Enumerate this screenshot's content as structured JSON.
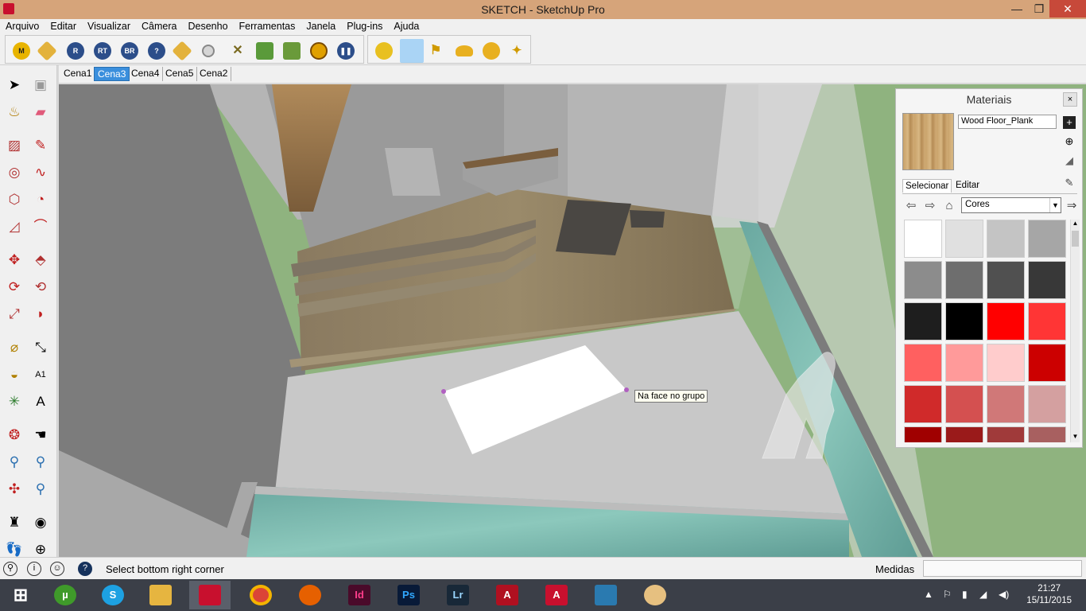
{
  "window": {
    "title": "SKETCH - SketchUp Pro",
    "controls": [
      "—",
      "❐",
      "✕"
    ]
  },
  "menu": [
    "Arquivo",
    "Editar",
    "Visualizar",
    "Câmera",
    "Desenho",
    "Ferramentas",
    "Janela",
    "Plug-ins",
    "Ajuda"
  ],
  "toolbar": {
    "plugin_labels": [
      "M",
      "R",
      "RT",
      "BR",
      "?"
    ]
  },
  "scenes": {
    "tabs": [
      "Cena1",
      "Cena3",
      "Cena4",
      "Cena5",
      "Cena2"
    ],
    "active": "Cena3"
  },
  "viewport": {
    "tooltip": "Na face no grupo"
  },
  "materials": {
    "title": "Materiais",
    "close": "×",
    "name": "Wood Floor_Plank",
    "tabs": [
      "Selecionar",
      "Editar"
    ],
    "library": "Cores",
    "swatch_colors": [
      "#ffffff",
      "#e0e0e0",
      "#c4c4c4",
      "#a6a6a6",
      "#8c8c8c",
      "#6e6e6e",
      "#505050",
      "#383838",
      "#1e1e1e",
      "#000000",
      "#ff0000",
      "#ff3535",
      "#ff6060",
      "#ff9a9a",
      "#ffcccc",
      "#cc0000",
      "#d02a2a",
      "#d45050",
      "#d07878",
      "#d4a0a0",
      "#a00000",
      "#9a1a1a",
      "#a03a3a",
      "#a86060"
    ]
  },
  "statusbar": {
    "message": "Select bottom right corner",
    "measures_label": "Medidas",
    "measures_value": ""
  },
  "taskbar": {
    "apps": [
      "Id",
      "Ps",
      "Lr"
    ],
    "time": "21:27",
    "date": "15/11/2015"
  }
}
